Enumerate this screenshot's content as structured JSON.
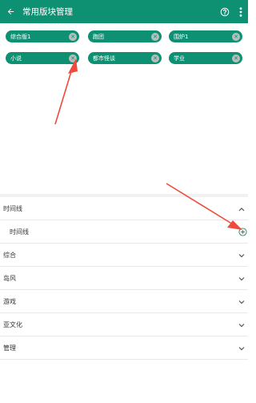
{
  "appbar": {
    "title": "常用版块管理",
    "icons": {
      "back": "back-arrow-icon",
      "help": "help-icon",
      "more": "more-vert-icon"
    }
  },
  "chips": [
    {
      "label": "综合版1"
    },
    {
      "label": "跑团"
    },
    {
      "label": "围炉1"
    },
    {
      "label": "小说"
    },
    {
      "label": "都市怪谈"
    },
    {
      "label": "学业"
    }
  ],
  "groups": [
    {
      "label": "时间线",
      "expanded": true,
      "children": [
        {
          "label": "时间线"
        }
      ]
    },
    {
      "label": "综合",
      "expanded": false
    },
    {
      "label": "岛风",
      "expanded": false
    },
    {
      "label": "游戏",
      "expanded": false
    },
    {
      "label": "亚文化",
      "expanded": false
    },
    {
      "label": "管理",
      "expanded": false
    }
  ],
  "colors": {
    "accent": "#0e9173",
    "chip_close": "#b7bfbc",
    "annotation": "#ef4a3c"
  }
}
